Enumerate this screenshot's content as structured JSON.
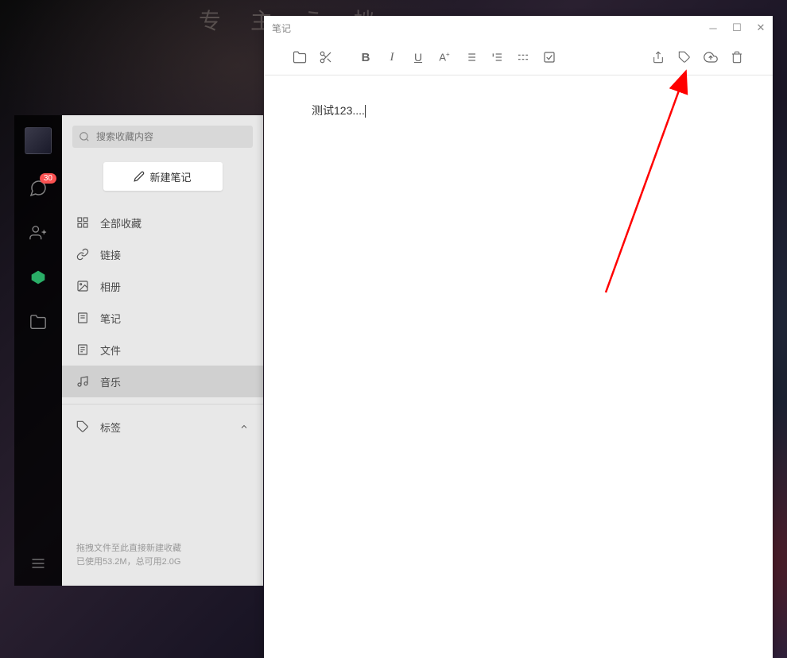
{
  "background_text": "专  主  う  挫",
  "note_window": {
    "title": "笔记",
    "content": "测试123....",
    "watermark": ""
  },
  "left_sidebar": {
    "chat_badge": "30"
  },
  "panel": {
    "search_placeholder": "搜索收藏内容",
    "new_note_label": "新建笔记",
    "categories": [
      {
        "label": "全部收藏",
        "icon": "grid"
      },
      {
        "label": "链接",
        "icon": "link"
      },
      {
        "label": "相册",
        "icon": "image"
      },
      {
        "label": "笔记",
        "icon": "note"
      },
      {
        "label": "文件",
        "icon": "file"
      },
      {
        "label": "音乐",
        "icon": "music"
      }
    ],
    "tag_label": "标签",
    "storage_line1": "拖拽文件至此直接新建收藏",
    "storage_line2": "已使用53.2M，总可用2.0G"
  }
}
